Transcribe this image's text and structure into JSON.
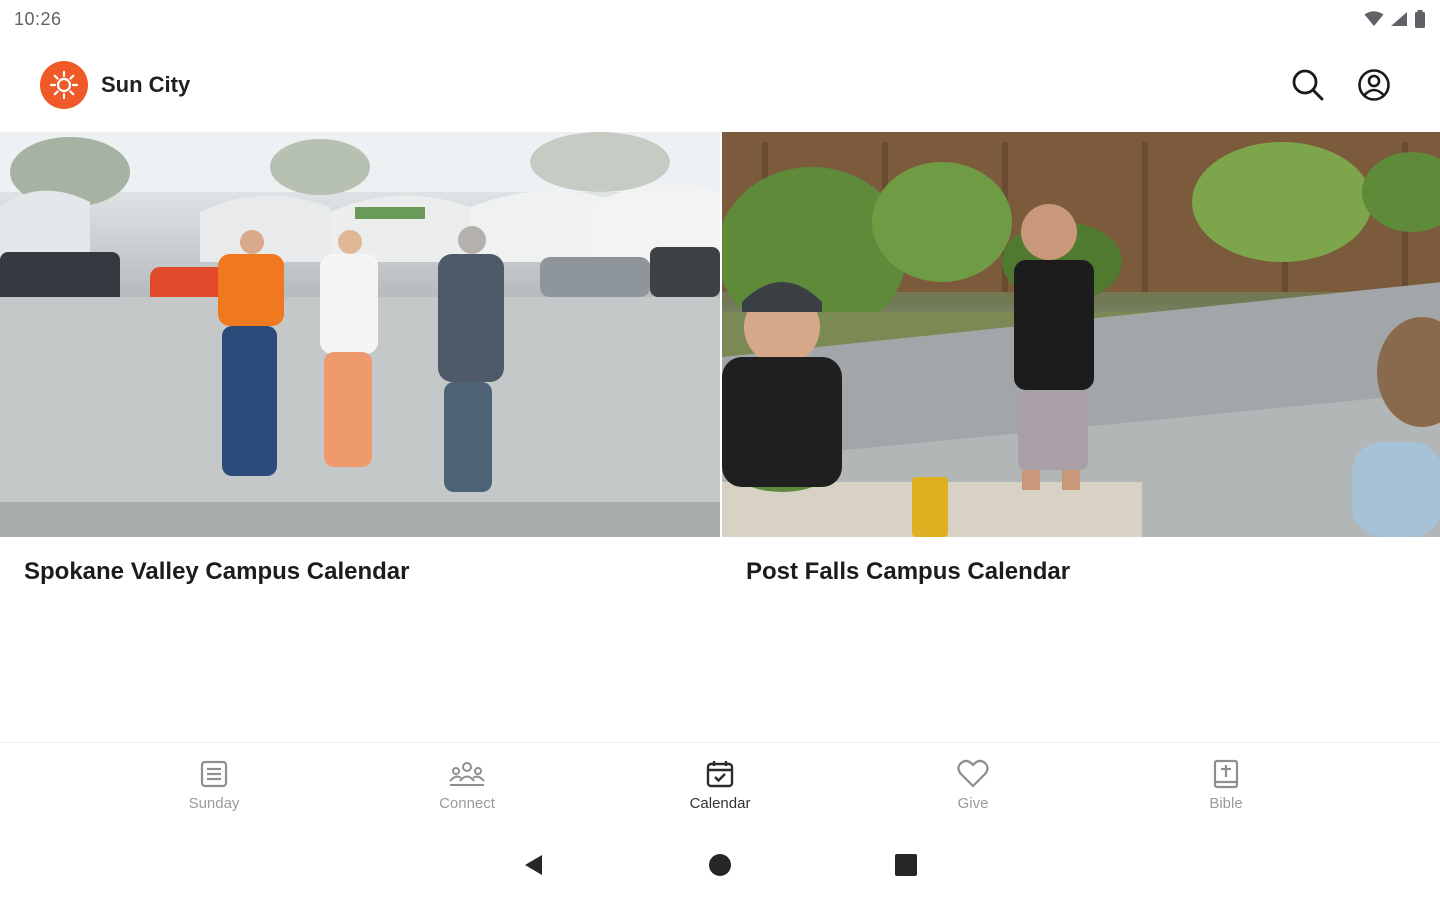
{
  "status_bar": {
    "time": "10:26",
    "icons": [
      "wifi-icon",
      "cell-signal-icon",
      "battery-icon"
    ]
  },
  "app_bar": {
    "brand_name": "Sun City",
    "logo_color": "#f05a28",
    "actions": [
      "search-icon",
      "account-icon"
    ]
  },
  "cards": [
    {
      "title": "Spokane Valley Campus Calendar"
    },
    {
      "title": "Post Falls Campus Calendar"
    }
  ],
  "bottom_nav": {
    "items": [
      {
        "label": "Sunday",
        "icon": "sunday-icon",
        "active": false
      },
      {
        "label": "Connect",
        "icon": "connect-icon",
        "active": false
      },
      {
        "label": "Calendar",
        "icon": "calendar-icon",
        "active": true
      },
      {
        "label": "Give",
        "icon": "heart-icon",
        "active": false
      },
      {
        "label": "Bible",
        "icon": "bible-icon",
        "active": false
      }
    ]
  },
  "system_nav": [
    "back-icon",
    "home-icon",
    "recents-icon"
  ]
}
